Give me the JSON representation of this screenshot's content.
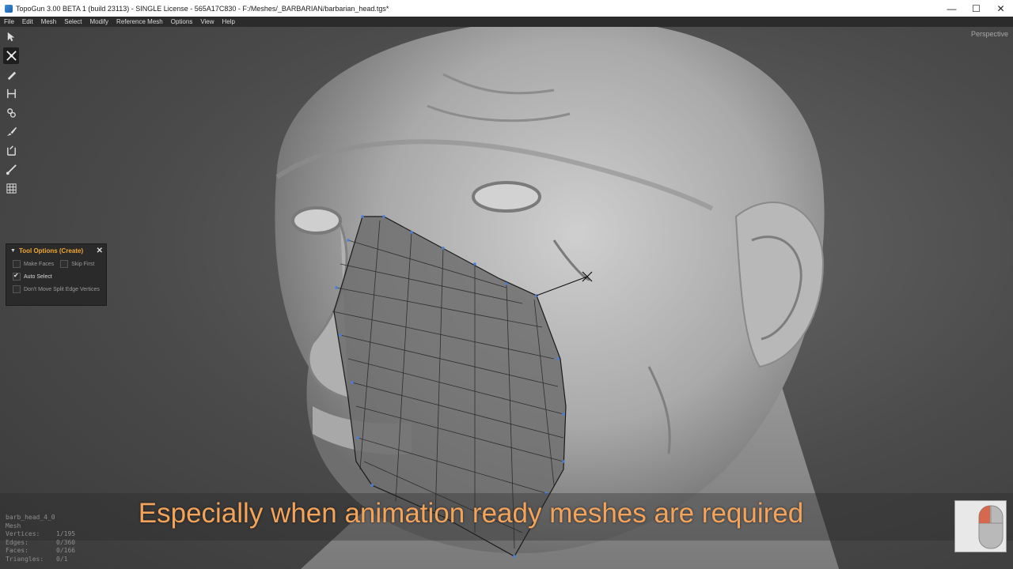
{
  "window": {
    "title": "TopoGun 3.00 BETA 1 (build 23113) - SINGLE License - 565A17C830 - F:/Meshes/_BARBARIAN/barbarian_head.tgs*",
    "minimize": "—",
    "maximize": "☐",
    "close": "✕"
  },
  "menu": [
    "File",
    "Edit",
    "Mesh",
    "Select",
    "Modify",
    "Reference Mesh",
    "Options",
    "View",
    "Help"
  ],
  "viewport": {
    "projection": "Perspective"
  },
  "toolbar": {
    "tools": [
      "select-tool-icon",
      "create-tool-icon",
      "draw-tool-icon",
      "bridge-tool-icon",
      "extrude-tool-icon",
      "brush-tool-icon",
      "edge-loop-tool-icon",
      "cut-tool-icon",
      "grid-tool-icon"
    ],
    "active": "create-tool-icon"
  },
  "tool_options": {
    "title": "Tool Options (Create)",
    "make_faces": {
      "label": "Make Faces",
      "checked": false
    },
    "skip_first": {
      "label": "Skip First",
      "checked": false
    },
    "auto_select": {
      "label": "Auto Select",
      "checked": true
    },
    "dont_move": {
      "label": "Don't Move Split Edge Vertices",
      "checked": false
    }
  },
  "mesh_stats": {
    "name": "barb_head_4_0",
    "type": "Mesh",
    "vertices_label": "Vertices:",
    "vertices": "1/195",
    "edges_label": "Edges:",
    "edges": "0/360",
    "faces_label": "Faces:",
    "faces": "0/166",
    "triangles_label": "Triangles:",
    "triangles": "0/1"
  },
  "subtitle": "Especially when animation ready meshes are required",
  "colors": {
    "accent_orange": "#f0a830",
    "subtitle": "#f3a45a",
    "vertex": "#4a7fd8"
  }
}
